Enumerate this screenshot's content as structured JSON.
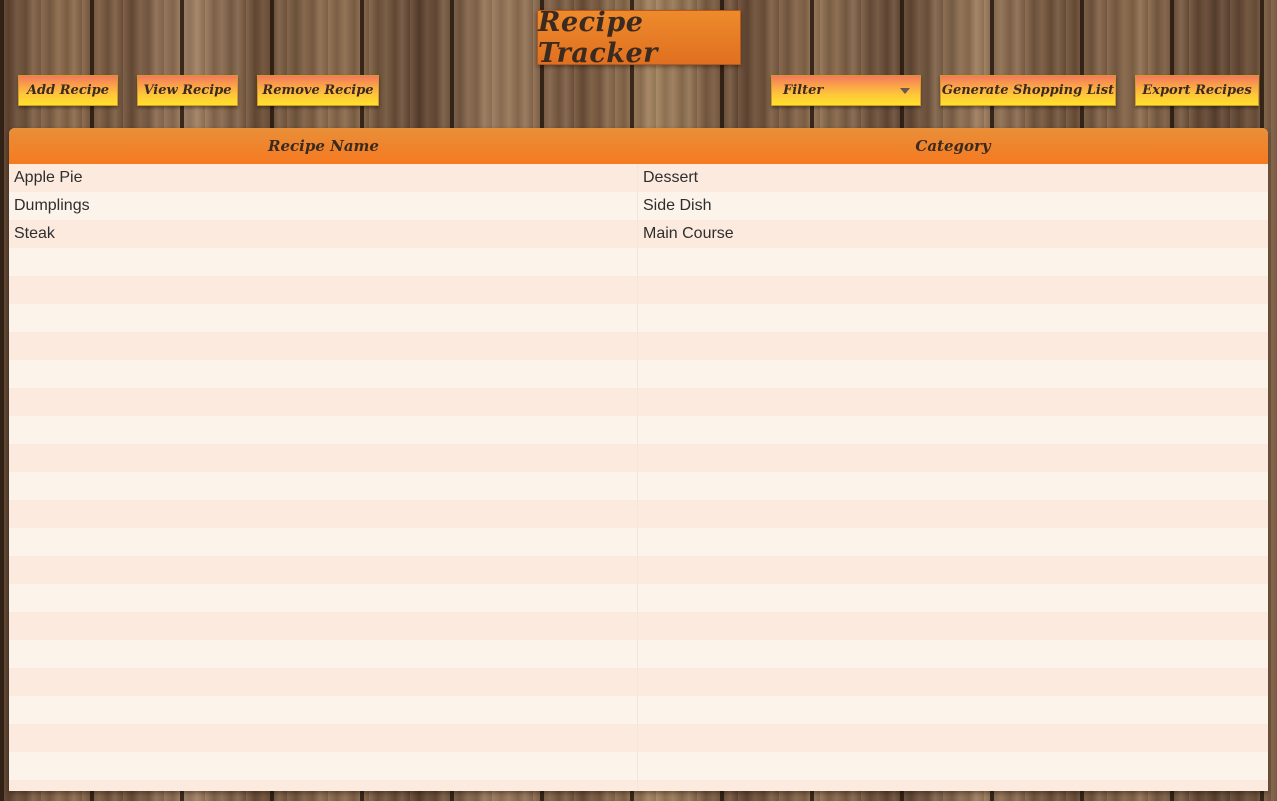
{
  "app": {
    "title": "Recipe Tracker"
  },
  "toolbar": {
    "add_label": "Add Recipe",
    "view_label": "View Recipe",
    "remove_label": "Remove Recipe",
    "filter_label": "Filter",
    "shopping_label": "Generate Shopping List",
    "export_label": "Export Recipes"
  },
  "table": {
    "columns": [
      "Recipe Name",
      "Category"
    ],
    "rows": [
      [
        "Apple Pie",
        "Dessert"
      ],
      [
        "Dumplings",
        "Side Dish"
      ],
      [
        "Steak",
        "Main Course"
      ]
    ]
  },
  "icons": {
    "filter_dropdown": "chevron-down-icon"
  },
  "colors": {
    "header_orange": "#f57a21",
    "button_gradient_top": "#f47a5a",
    "button_gradient_bottom": "#ffe12a",
    "row_odd": "#fbeadd",
    "row_even": "#fcf3ea"
  }
}
